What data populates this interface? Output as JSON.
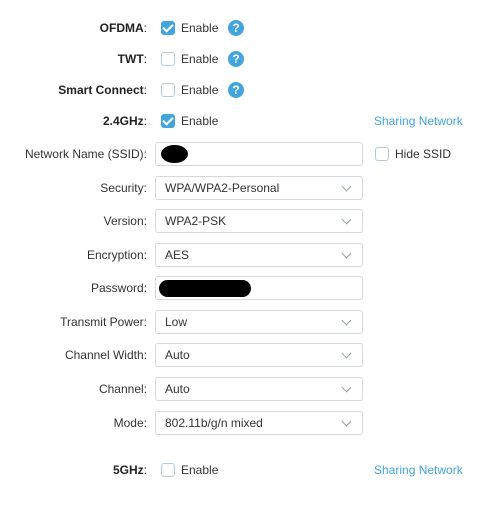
{
  "ofdma": {
    "label": "OFDMA",
    "checked": true,
    "option": "Enable",
    "help_icon": "question-icon"
  },
  "twt": {
    "label": "TWT",
    "checked": false,
    "option": "Enable",
    "help_icon": "question-icon"
  },
  "smart_connect": {
    "label": "Smart Connect",
    "checked": false,
    "option": "Enable",
    "help_icon": "question-icon"
  },
  "band_24": {
    "label": "2.4GHz",
    "checked": true,
    "option": "Enable",
    "sharing": "Sharing Network"
  },
  "ssid": {
    "label": "Network Name (SSID)",
    "value": "",
    "hide_label": "Hide SSID",
    "hide_checked": false
  },
  "security": {
    "label": "Security",
    "value": "WPA/WPA2-Personal"
  },
  "version": {
    "label": "Version",
    "value": "WPA2-PSK"
  },
  "encryption": {
    "label": "Encryption",
    "value": "AES"
  },
  "password": {
    "label": "Password",
    "value": ""
  },
  "transmit_power": {
    "label": "Transmit Power",
    "value": "Low"
  },
  "channel_width": {
    "label": "Channel Width",
    "value": "Auto"
  },
  "channel": {
    "label": "Channel",
    "value": "Auto"
  },
  "mode": {
    "label": "Mode",
    "value": "802.11b/g/n mixed"
  },
  "band_5": {
    "label": "5GHz",
    "checked": false,
    "option": "Enable",
    "sharing": "Sharing Network"
  },
  "colors": {
    "accent": "#42a5db",
    "border": "#d5d9de",
    "text": "#333333"
  }
}
